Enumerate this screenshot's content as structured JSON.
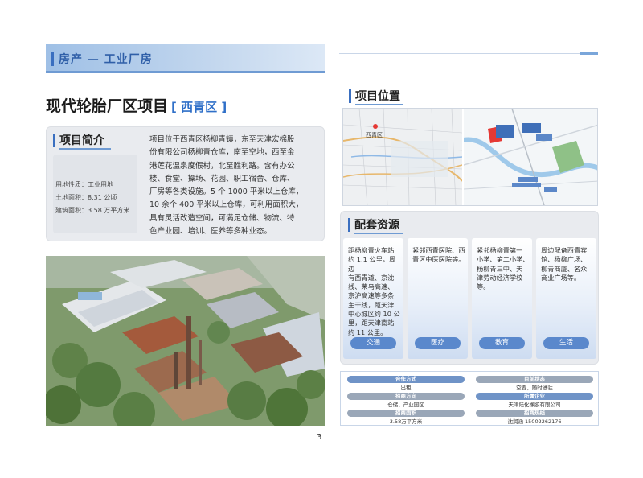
{
  "header": {
    "section_title": "房产 — 工业厂房"
  },
  "project": {
    "title": "现代轮胎厂区项目",
    "district": "[ 西青区 ]"
  },
  "intro": {
    "heading": "项目简介",
    "facts": [
      {
        "label": "用地性质：",
        "value": "工业用地"
      },
      {
        "label": "土地面积：",
        "value": "8.31 公顷"
      },
      {
        "label": "建筑面积：",
        "value": "3.58 万平方米"
      }
    ],
    "lines": [
      "项目位于西青区杨柳青镇，东至天津宏棉股",
      "份有限公司杨柳青仓库，南至空地，西至金",
      "港莲花温泉度假村，北至胜利路。含有办公",
      "楼、食堂、操场、花园、职工宿舍、仓库、",
      "厂房等各类设施。5 个 1000 平米以上仓库，",
      "10 余个 400 平米以上仓库，可利用面积大，",
      "具有灵活改造空间，可满足仓储、物流、特",
      "色产业园、培训、医养等多种业态。"
    ]
  },
  "location": {
    "heading": "项目位置",
    "map_labels": {
      "city": "西青区"
    }
  },
  "resources": {
    "heading": "配套资源",
    "columns": [
      {
        "lines": [
          "距杨柳青火车站",
          "约 1.1 公里，周边",
          "有西青道、京沈",
          "线、荣乌高速、",
          "京沪高速等多条",
          "主干线，距天津",
          "中心城区约 10 公",
          "里，距天津南站",
          "约 11 公里。"
        ],
        "button": "交通"
      },
      {
        "lines": [
          "紧邻西青医院、西",
          "青区中医医院等。"
        ],
        "button": "医疗"
      },
      {
        "lines": [
          "紧邻杨柳青第一",
          "小学、第二小学、",
          "杨柳青三中、天",
          "津劳动经济学校",
          "等。"
        ],
        "button": "教育"
      },
      {
        "lines": [
          "周边配备西青宾",
          "馆、杨柳广场、",
          "柳青商厦、名众",
          "商业广场等。"
        ],
        "button": "生活"
      }
    ]
  },
  "info": {
    "left": [
      {
        "label": "合作方式",
        "value": "出租"
      },
      {
        "label": "招商方向",
        "value": "仓储、产业园区"
      },
      {
        "label": "招商面积",
        "value": "3.58万平方米"
      }
    ],
    "right": [
      {
        "label": "目前状态",
        "value": "空置，随时进驻"
      },
      {
        "label": "所属企业",
        "value": "天津陆化橡胶有限公司"
      },
      {
        "label": "招商热线",
        "value": "沈润涵 15002262176"
      }
    ]
  },
  "page_number": "3",
  "colors": {
    "accent": "#3a6fc0",
    "pill": "#5a88cc",
    "box": "#e9ebef"
  }
}
